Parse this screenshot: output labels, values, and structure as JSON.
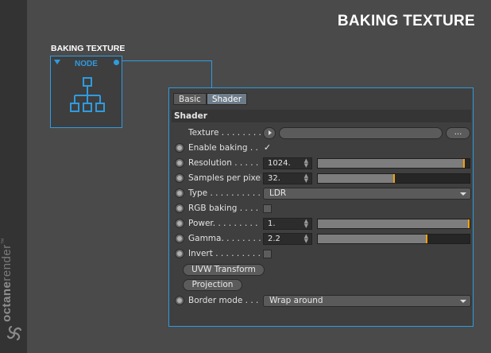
{
  "page_title": "BAKING TEXTURE",
  "node": {
    "title": "BAKING TEXTURE",
    "label": "NODE",
    "icon": "hierarchy-icon",
    "accent": "#2f9be0"
  },
  "brand": {
    "text_bold": "octane",
    "text_light": "render",
    "tm": "™"
  },
  "panel": {
    "tabs": [
      {
        "label": "Basic",
        "active": false
      },
      {
        "label": "Shader",
        "active": true
      }
    ],
    "section": "Shader",
    "texture": {
      "label": "Texture . . . . . . . . .",
      "more_label": "..."
    },
    "enable_baking": {
      "label": "Enable baking . . .",
      "checked": true,
      "mark": "✓"
    },
    "resolution": {
      "label": "Resolution . . . . . .",
      "value": "1024.",
      "fill": 0.97
    },
    "samples": {
      "label": "Samples per pixel",
      "value": "32.",
      "fill": 0.51
    },
    "type": {
      "label": "Type . . . . . . . . . . .",
      "value": "LDR"
    },
    "rgb_baking": {
      "label": "RGB baking . . . . . .",
      "checked": false
    },
    "power": {
      "label": "Power. . . . . . . . . .",
      "value": "1.",
      "fill": 1.0
    },
    "gamma": {
      "label": "Gamma. . . . . . . . .",
      "value": "2.2",
      "fill": 0.72
    },
    "invert": {
      "label": "Invert . . . . . . . . . .",
      "checked": false
    },
    "uvw_button": "UVW Transform",
    "projection_button": "Projection",
    "border_mode": {
      "label": "Border mode . . . .",
      "value": "Wrap around"
    }
  }
}
